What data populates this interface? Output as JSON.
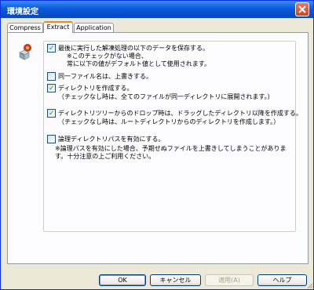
{
  "window": {
    "title": "環境設定"
  },
  "tabs": [
    {
      "label": "Compress"
    },
    {
      "label": "Extract"
    },
    {
      "label": "Application"
    }
  ],
  "options": [
    {
      "label": "最後に実行した解凍処理の以下のデータを保存する。",
      "checked": true,
      "notes": [
        "※このチェックがない場合、",
        "常に以下の値がデフォルト値として使用されます。"
      ]
    },
    {
      "label": "同一ファイル名は、上書きする。",
      "checked": false,
      "notes": []
    },
    {
      "label": "ディレクトリを作成する。",
      "checked": true,
      "notes": [
        "（チェックなし時は、全てのファイルが同一ディレクトリに展開されます。）"
      ]
    },
    {
      "label": "ディレクトリツリーからのドロップ時は、ドラッグしたディレクトリ以降を作成する。",
      "checked": true,
      "notes": [
        "（チェックなし時は、ルートディレクトリからのディレクトリを作成します。）"
      ]
    },
    {
      "label": "論理ディレクトリパスを有効にする。",
      "checked": false,
      "notes": [
        "※論理パスを有効にした場合、予期せぬファイルを上書きしてしまうことがありま",
        "す。十分注意の上ご利用ください。"
      ]
    }
  ],
  "buttons": {
    "ok": "OK",
    "cancel": "キャンセル",
    "apply": "適用(A)",
    "help": "ヘルプ"
  },
  "icons": {
    "app": "cube-app-icon",
    "close": "close-icon"
  },
  "colors": {
    "titlebar": "#0a5bdc",
    "panel": "#fcfcfe",
    "check": "#21a121"
  }
}
